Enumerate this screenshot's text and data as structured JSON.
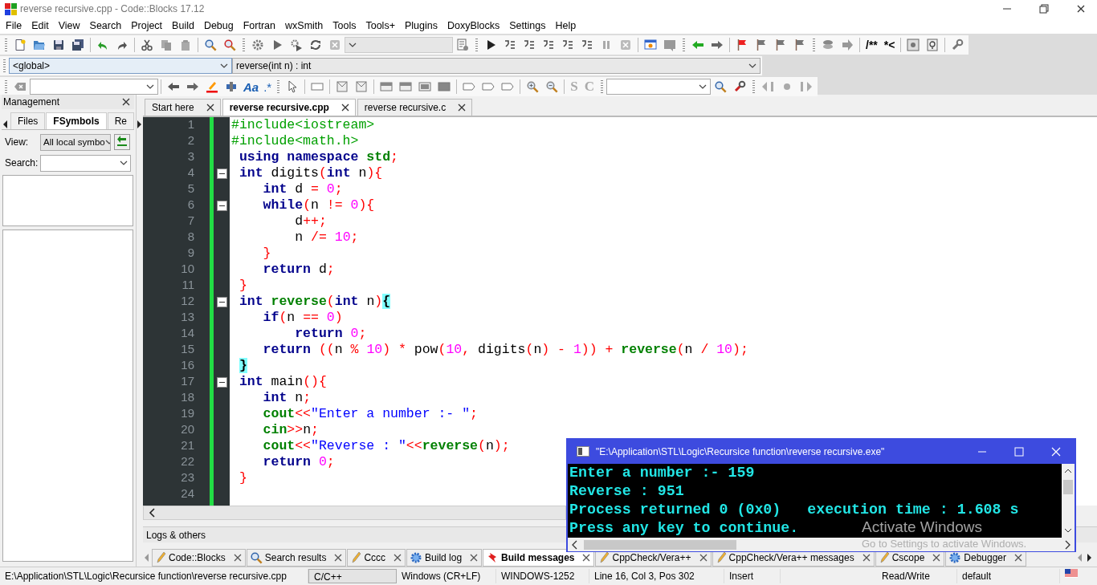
{
  "window": {
    "title": "reverse recursive.cpp - Code::Blocks 17.12"
  },
  "menu": [
    "File",
    "Edit",
    "View",
    "Search",
    "Project",
    "Build",
    "Debug",
    "Fortran",
    "wxSmith",
    "Tools",
    "Tools+",
    "Plugins",
    "DoxyBlocks",
    "Settings",
    "Help"
  ],
  "toolbar": {
    "target_combo": {
      "disabled": true
    },
    "comment_buttons": [
      "/**",
      "*<"
    ]
  },
  "scope_bar": {
    "scope": "<global>",
    "function": "reverse(int n) : int"
  },
  "search_toolbar": {
    "case_label": "Aa",
    "regex_label": ".*"
  },
  "wxsmith_toolbar": {
    "letters": [
      "S",
      "C"
    ]
  },
  "management": {
    "title": "Management",
    "tabs": [
      {
        "label": "Files",
        "selected": false
      },
      {
        "label": "FSymbols",
        "selected": true
      },
      {
        "label": "Re",
        "selected": false
      }
    ],
    "view_label": "View:",
    "view_value": "All local symbo",
    "search_label": "Search:"
  },
  "editor": {
    "tabs": [
      {
        "label": "Start here",
        "selected": false
      },
      {
        "label": "reverse recursive.cpp",
        "selected": true
      },
      {
        "label": "reverse recursive.c",
        "selected": false
      }
    ],
    "lines": [
      {
        "number": "1",
        "fold": false,
        "tokens": [
          {
            "kind": "pp",
            "text": "#include<iostream>"
          }
        ]
      },
      {
        "number": "2",
        "fold": false,
        "tokens": [
          {
            "kind": "pp",
            "text": "#include<math.h>"
          }
        ]
      },
      {
        "number": "3",
        "fold": false,
        "tokens": [
          {
            "kind": "kw",
            "text": " using"
          },
          {
            "kind": "kw",
            "text": " namespace"
          },
          {
            "kind": "lib",
            "text": " std"
          },
          {
            "kind": "op",
            "text": ";"
          }
        ]
      },
      {
        "number": "4",
        "fold": true,
        "tokens": [
          {
            "kind": "kw",
            "text": " int"
          },
          {
            "kind": "id",
            "text": " digits"
          },
          {
            "kind": "op",
            "text": "("
          },
          {
            "kind": "kw",
            "text": "int"
          },
          {
            "kind": "id",
            "text": " n"
          },
          {
            "kind": "op",
            "text": "){"
          }
        ]
      },
      {
        "number": "5",
        "fold": false,
        "tokens": [
          {
            "kind": "kw",
            "text": "    int"
          },
          {
            "kind": "id",
            "text": " d "
          },
          {
            "kind": "op",
            "text": "="
          },
          {
            "kind": "num",
            "text": " 0"
          },
          {
            "kind": "op",
            "text": ";"
          }
        ]
      },
      {
        "number": "6",
        "fold": true,
        "tokens": [
          {
            "kind": "kw",
            "text": "    while"
          },
          {
            "kind": "op",
            "text": "("
          },
          {
            "kind": "id",
            "text": "n "
          },
          {
            "kind": "op",
            "text": "!="
          },
          {
            "kind": "num",
            "text": " 0"
          },
          {
            "kind": "op",
            "text": "){"
          }
        ]
      },
      {
        "number": "7",
        "fold": false,
        "tokens": [
          {
            "kind": "id",
            "text": "        d"
          },
          {
            "kind": "op",
            "text": "++;"
          }
        ]
      },
      {
        "number": "8",
        "fold": false,
        "tokens": [
          {
            "kind": "id",
            "text": "        n "
          },
          {
            "kind": "op",
            "text": "/="
          },
          {
            "kind": "num",
            "text": " 10"
          },
          {
            "kind": "op",
            "text": ";"
          }
        ]
      },
      {
        "number": "9",
        "fold": false,
        "tokens": [
          {
            "kind": "op",
            "text": "    }"
          }
        ]
      },
      {
        "number": "10",
        "fold": false,
        "tokens": [
          {
            "kind": "kw",
            "text": "    return"
          },
          {
            "kind": "id",
            "text": " d"
          },
          {
            "kind": "op",
            "text": ";"
          }
        ]
      },
      {
        "number": "11",
        "fold": false,
        "tokens": [
          {
            "kind": "op",
            "text": " }"
          }
        ]
      },
      {
        "number": "12",
        "fold": true,
        "tokens": [
          {
            "kind": "kw",
            "text": " int"
          },
          {
            "kind": "lib",
            "text": " reverse"
          },
          {
            "kind": "op",
            "text": "("
          },
          {
            "kind": "kw",
            "text": "int"
          },
          {
            "kind": "id",
            "text": " n"
          },
          {
            "kind": "op",
            "text": ")"
          },
          {
            "kind": "brace",
            "text": "{"
          }
        ]
      },
      {
        "number": "13",
        "fold": false,
        "tokens": [
          {
            "kind": "kw",
            "text": "    if"
          },
          {
            "kind": "op",
            "text": "("
          },
          {
            "kind": "id",
            "text": "n "
          },
          {
            "kind": "op",
            "text": "=="
          },
          {
            "kind": "num",
            "text": " 0"
          },
          {
            "kind": "op",
            "text": ")"
          }
        ]
      },
      {
        "number": "14",
        "fold": false,
        "tokens": [
          {
            "kind": "kw",
            "text": "        return"
          },
          {
            "kind": "num",
            "text": " 0"
          },
          {
            "kind": "op",
            "text": ";"
          }
        ]
      },
      {
        "number": "15",
        "fold": false,
        "tokens": [
          {
            "kind": "kw",
            "text": "    return"
          },
          {
            "kind": "op",
            "text": " (("
          },
          {
            "kind": "id",
            "text": "n "
          },
          {
            "kind": "op",
            "text": "%"
          },
          {
            "kind": "num",
            "text": " 10"
          },
          {
            "kind": "op",
            "text": ")"
          },
          {
            "kind": "op",
            "text": " *"
          },
          {
            "kind": "id",
            "text": " pow"
          },
          {
            "kind": "op",
            "text": "("
          },
          {
            "kind": "num",
            "text": "10"
          },
          {
            "kind": "op",
            "text": ","
          },
          {
            "kind": "id",
            "text": " digits"
          },
          {
            "kind": "op",
            "text": "("
          },
          {
            "kind": "id",
            "text": "n"
          },
          {
            "kind": "op",
            "text": ")"
          },
          {
            "kind": "op",
            "text": " -"
          },
          {
            "kind": "num",
            "text": " 1"
          },
          {
            "kind": "op",
            "text": "))"
          },
          {
            "kind": "op",
            "text": " +"
          },
          {
            "kind": "lib",
            "text": " reverse"
          },
          {
            "kind": "op",
            "text": "("
          },
          {
            "kind": "id",
            "text": "n "
          },
          {
            "kind": "op",
            "text": "/"
          },
          {
            "kind": "num",
            "text": " 10"
          },
          {
            "kind": "op",
            "text": ");"
          }
        ]
      },
      {
        "number": "16",
        "fold": false,
        "tokens": [
          {
            "kind": "brace",
            "text": " }"
          }
        ]
      },
      {
        "number": "17",
        "fold": true,
        "tokens": [
          {
            "kind": "kw",
            "text": " int"
          },
          {
            "kind": "id",
            "text": " main"
          },
          {
            "kind": "op",
            "text": "(){"
          }
        ]
      },
      {
        "number": "18",
        "fold": false,
        "tokens": [
          {
            "kind": "kw",
            "text": "    int"
          },
          {
            "kind": "id",
            "text": " n"
          },
          {
            "kind": "op",
            "text": ";"
          }
        ]
      },
      {
        "number": "19",
        "fold": false,
        "tokens": [
          {
            "kind": "lib",
            "text": "    cout"
          },
          {
            "kind": "op",
            "text": "<<"
          },
          {
            "kind": "str",
            "text": "\"Enter a number :- \""
          },
          {
            "kind": "op",
            "text": ";"
          }
        ]
      },
      {
        "number": "20",
        "fold": false,
        "tokens": [
          {
            "kind": "lib",
            "text": "    cin"
          },
          {
            "kind": "op",
            "text": ">>"
          },
          {
            "kind": "id",
            "text": "n"
          },
          {
            "kind": "op",
            "text": ";"
          }
        ]
      },
      {
        "number": "21",
        "fold": false,
        "tokens": [
          {
            "kind": "lib",
            "text": "    cout"
          },
          {
            "kind": "op",
            "text": "<<"
          },
          {
            "kind": "str",
            "text": "\"Reverse : \""
          },
          {
            "kind": "op",
            "text": "<<"
          },
          {
            "kind": "lib",
            "text": "reverse"
          },
          {
            "kind": "op",
            "text": "("
          },
          {
            "kind": "id",
            "text": "n"
          },
          {
            "kind": "op",
            "text": ");"
          }
        ]
      },
      {
        "number": "22",
        "fold": false,
        "tokens": [
          {
            "kind": "kw",
            "text": "    return"
          },
          {
            "kind": "num",
            "text": " 0"
          },
          {
            "kind": "op",
            "text": ";"
          }
        ]
      },
      {
        "number": "23",
        "fold": false,
        "tokens": [
          {
            "kind": "op",
            "text": " }"
          }
        ]
      },
      {
        "number": "24",
        "fold": false
      }
    ]
  },
  "logs": {
    "title": "Logs & others",
    "tabs": [
      {
        "label": "Code::Blocks",
        "selected": false,
        "kind": "pencil"
      },
      {
        "label": "Search results",
        "selected": false,
        "kind": "search"
      },
      {
        "label": "Cccc",
        "selected": false,
        "kind": "pencil"
      },
      {
        "label": "Build log",
        "selected": false,
        "kind": "gear"
      },
      {
        "label": "Build messages",
        "selected": true,
        "kind": "pin"
      },
      {
        "label": "CppCheck/Vera++",
        "selected": false,
        "kind": "pencil"
      },
      {
        "label": "CppCheck/Vera++ messages",
        "selected": false,
        "kind": "pencil"
      },
      {
        "label": "Cscope",
        "selected": false,
        "kind": "pencil"
      },
      {
        "label": "Debugger",
        "selected": false,
        "kind": "gear"
      }
    ]
  },
  "console": {
    "title": "\"E:\\Application\\STL\\Logic\\Recursice function\\reverse recursive.exe\"",
    "output": [
      "Enter a number :- 159",
      "Reverse : 951",
      "Process returned 0 (0x0)   execution time : 1.608 s",
      "Press any key to continue."
    ]
  },
  "os_notice": {
    "title": "Activate Windows",
    "subtitle": "Go to Settings to activate Windows."
  },
  "status_bar": [
    {
      "text": "E:\\Application\\STL\\Logic\\Recursice function\\reverse recursive.cpp",
      "kind": "plain"
    },
    {
      "text": "C/C++",
      "kind": "sunken"
    },
    {
      "text": "Windows (CR+LF)",
      "kind": "plain"
    },
    {
      "text": "WINDOWS-1252",
      "kind": "plain"
    },
    {
      "text": "Line 16, Col 3, Pos 302",
      "kind": "plain"
    },
    {
      "text": "Insert",
      "kind": "plain"
    },
    {
      "text": "Read/Write",
      "kind": "plain"
    },
    {
      "text": "default",
      "kind": "plain"
    }
  ]
}
